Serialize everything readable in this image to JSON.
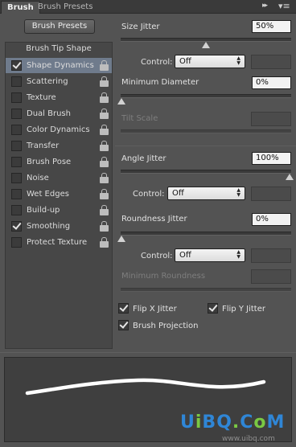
{
  "tabs": {
    "active": "Brush",
    "inactive": "Brush Presets",
    "collapse_glyph": "▸▸",
    "menu_glyph": "▾≡"
  },
  "presets_button": "Brush Presets",
  "list": {
    "header": "Brush Tip Shape",
    "items": [
      {
        "label": "Shape Dynamics",
        "checked": true,
        "selected": true
      },
      {
        "label": "Scattering",
        "checked": false
      },
      {
        "label": "Texture",
        "checked": false
      },
      {
        "label": "Dual Brush",
        "checked": false
      },
      {
        "label": "Color Dynamics",
        "checked": false
      },
      {
        "label": "Transfer",
        "checked": false
      },
      {
        "label": "Brush Pose",
        "checked": false
      },
      {
        "label": "Noise",
        "checked": false
      },
      {
        "label": "Wet Edges",
        "checked": false
      },
      {
        "label": "Build-up",
        "checked": false
      },
      {
        "label": "Smoothing",
        "checked": true
      },
      {
        "label": "Protect Texture",
        "checked": false
      }
    ]
  },
  "settings": {
    "size_jitter": {
      "label": "Size Jitter",
      "value": "50%",
      "slider": 0.5
    },
    "size_control": {
      "label": "Control:",
      "value": "Off"
    },
    "min_diameter": {
      "label": "Minimum Diameter",
      "value": "0%",
      "slider": 0
    },
    "tilt_scale": {
      "label": "Tilt Scale"
    },
    "angle_jitter": {
      "label": "Angle Jitter",
      "value": "100%",
      "slider": 1
    },
    "angle_control": {
      "label": "Control:",
      "value": "Off"
    },
    "roundness_jitter": {
      "label": "Roundness Jitter",
      "value": "0%",
      "slider": 0
    },
    "roundness_control": {
      "label": "Control:",
      "value": "Off"
    },
    "min_roundness": {
      "label": "Minimum Roundness"
    },
    "flip_x": {
      "label": "Flip X Jitter",
      "checked": true
    },
    "flip_y": {
      "label": "Flip Y Jitter",
      "checked": true
    },
    "brush_projection": {
      "label": "Brush Projection",
      "checked": true
    }
  },
  "watermark": {
    "logo": "UiBQ.CoM",
    "site": "www.uibq.com"
  },
  "colors": {
    "panel": "#535353",
    "selected_row": "#6f7b8c",
    "stroke": "#ffffff"
  },
  "icons": [
    "lock-icon",
    "checkbox-checked-icon",
    "dropdown-arrows-icon",
    "panel-menu-icon",
    "collapse-icon"
  ]
}
